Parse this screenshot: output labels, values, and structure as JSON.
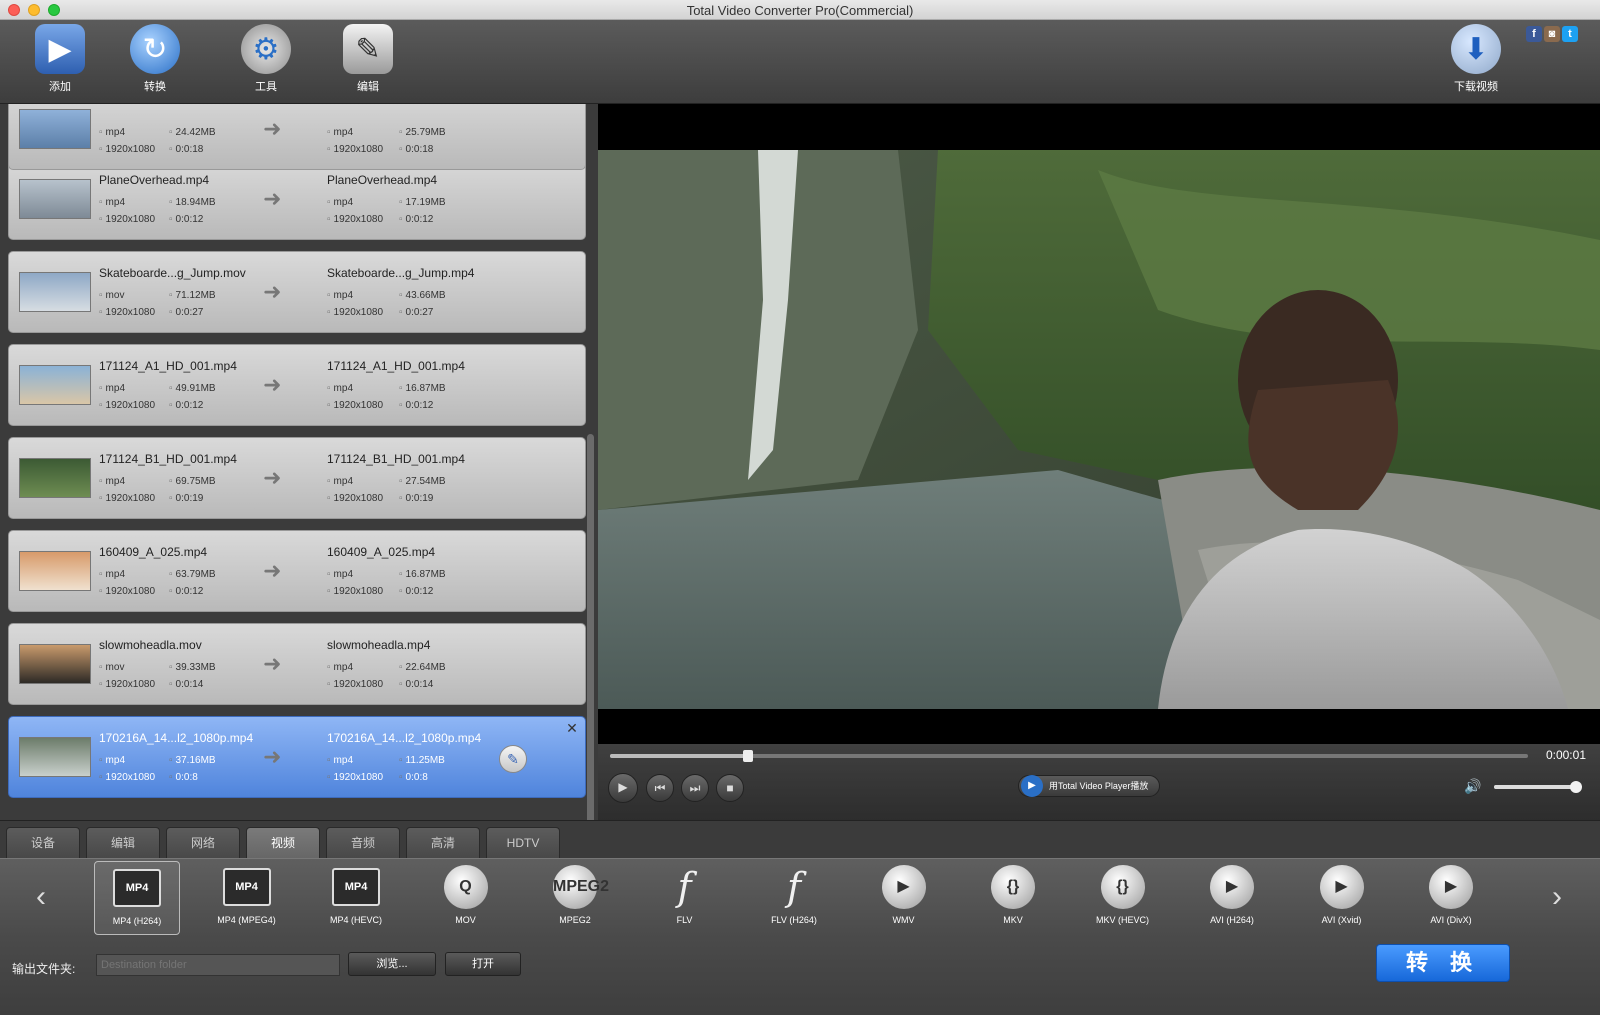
{
  "window": {
    "title": "Total Video Converter Pro(Commercial)"
  },
  "toolbar": {
    "add_label": "添加",
    "convert_label": "转换",
    "tools_label": "工具",
    "edit_label": "编辑",
    "download_label": "下载视频"
  },
  "files": [
    {
      "src_name": "",
      "src_fmt": "mp4",
      "src_size": "24.42MB",
      "src_res": "1920x1080",
      "src_dur": "0:0:18",
      "out_name": "",
      "out_fmt": "mp4",
      "out_size": "25.79MB",
      "out_res": "1920x1080",
      "out_dur": "0:0:18"
    },
    {
      "src_name": "PlaneOverhead.mp4",
      "src_fmt": "mp4",
      "src_size": "18.94MB",
      "src_res": "1920x1080",
      "src_dur": "0:0:12",
      "out_name": "PlaneOverhead.mp4",
      "out_fmt": "mp4",
      "out_size": "17.19MB",
      "out_res": "1920x1080",
      "out_dur": "0:0:12"
    },
    {
      "src_name": "Skateboarde...g_Jump.mov",
      "src_fmt": "mov",
      "src_size": "71.12MB",
      "src_res": "1920x1080",
      "src_dur": "0:0:27",
      "out_name": "Skateboarde...g_Jump.mp4",
      "out_fmt": "mp4",
      "out_size": "43.66MB",
      "out_res": "1920x1080",
      "out_dur": "0:0:27"
    },
    {
      "src_name": "171124_A1_HD_001.mp4",
      "src_fmt": "mp4",
      "src_size": "49.91MB",
      "src_res": "1920x1080",
      "src_dur": "0:0:12",
      "out_name": "171124_A1_HD_001.mp4",
      "out_fmt": "mp4",
      "out_size": "16.87MB",
      "out_res": "1920x1080",
      "out_dur": "0:0:12"
    },
    {
      "src_name": "171124_B1_HD_001.mp4",
      "src_fmt": "mp4",
      "src_size": "69.75MB",
      "src_res": "1920x1080",
      "src_dur": "0:0:19",
      "out_name": "171124_B1_HD_001.mp4",
      "out_fmt": "mp4",
      "out_size": "27.54MB",
      "out_res": "1920x1080",
      "out_dur": "0:0:19"
    },
    {
      "src_name": "160409_A_025.mp4",
      "src_fmt": "mp4",
      "src_size": "63.79MB",
      "src_res": "1920x1080",
      "src_dur": "0:0:12",
      "out_name": "160409_A_025.mp4",
      "out_fmt": "mp4",
      "out_size": "16.87MB",
      "out_res": "1920x1080",
      "out_dur": "0:0:12"
    },
    {
      "src_name": "slowmoheadla.mov",
      "src_fmt": "mov",
      "src_size": "39.33MB",
      "src_res": "1920x1080",
      "src_dur": "0:0:14",
      "out_name": "slowmoheadla.mp4",
      "out_fmt": "mp4",
      "out_size": "22.64MB",
      "out_res": "1920x1080",
      "out_dur": "0:0:14"
    },
    {
      "src_name": "170216A_14...l2_1080p.mp4",
      "src_fmt": "mp4",
      "src_size": "37.16MB",
      "src_res": "1920x1080",
      "src_dur": "0:0:8",
      "out_name": "170216A_14...l2_1080p.mp4",
      "out_fmt": "mp4",
      "out_size": "11.25MB",
      "out_res": "1920x1080",
      "out_dur": "0:0:8"
    }
  ],
  "player": {
    "time": "0:00:01",
    "progress_fraction": 0.15,
    "volume_fraction": 0.95,
    "tvp_label": "用Total Video Player播放"
  },
  "tabs": [
    "设备",
    "编辑",
    "网络",
    "视频",
    "音频",
    "高清",
    "HDTV"
  ],
  "formats": [
    {
      "label": "MP4 (H264)",
      "badge": "MP4",
      "icon": "mp4-film-icon"
    },
    {
      "label": "MP4 (MPEG4)",
      "badge": "MP4",
      "icon": "mp4-film-icon"
    },
    {
      "label": "MP4 (HEVC)",
      "badge": "MP4",
      "icon": "mp4-film-icon"
    },
    {
      "label": "MOV",
      "badge": "Q",
      "icon": "quicktime-icon"
    },
    {
      "label": "MPEG2",
      "badge": "MPEG2",
      "icon": "mpeg2-reel-icon"
    },
    {
      "label": "FLV",
      "badge": "f",
      "icon": "flash-icon"
    },
    {
      "label": "FLV (H264)",
      "badge": "f",
      "icon": "flash-icon"
    },
    {
      "label": "WMV",
      "badge": "▶",
      "icon": "play-circle-icon"
    },
    {
      "label": "MKV",
      "badge": "{}",
      "icon": "mkv-icon"
    },
    {
      "label": "MKV (HEVC)",
      "badge": "{}",
      "icon": "mkv-icon"
    },
    {
      "label": "AVI (H264)",
      "badge": "▶",
      "icon": "play-circle-icon"
    },
    {
      "label": "AVI (Xvid)",
      "badge": "▶",
      "icon": "play-circle-icon"
    },
    {
      "label": "AVI (DivX)",
      "badge": "▶",
      "icon": "play-circle-icon"
    }
  ],
  "bottom": {
    "output_label": "输出文件夹:",
    "output_placeholder": "Destination folder",
    "browse_label": "浏览...",
    "open_label": "打开",
    "convert_label": "转 换"
  }
}
